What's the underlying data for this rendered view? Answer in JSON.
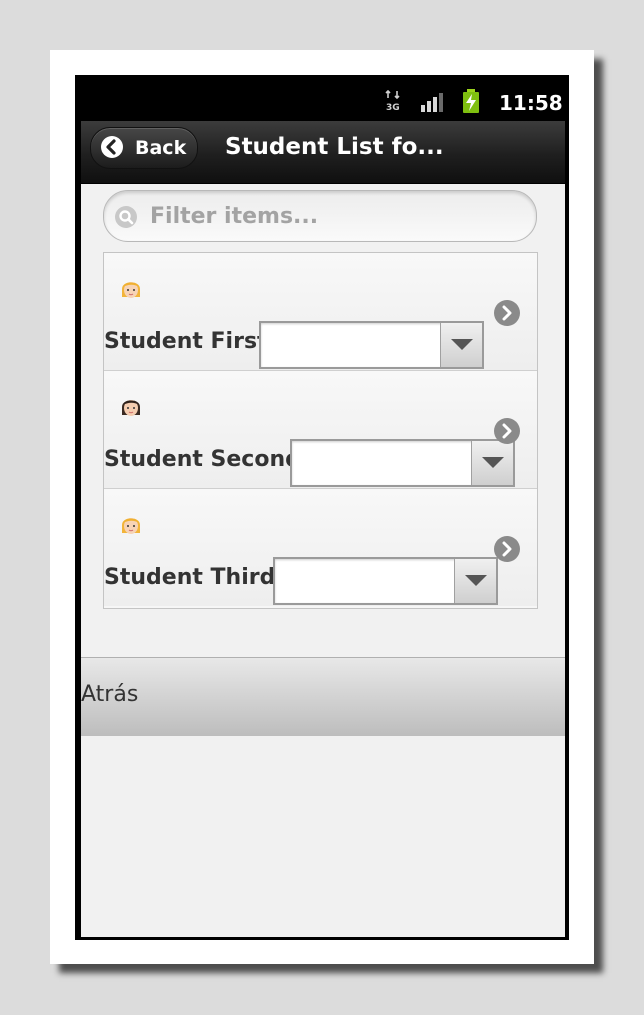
{
  "status_bar": {
    "network": "3G",
    "time": "11:58"
  },
  "header": {
    "back_label": "Back",
    "title": "Student List fo..."
  },
  "filter": {
    "placeholder": "Filter items...",
    "value": ""
  },
  "students": [
    {
      "name": "Student First",
      "avatar": "blonde-girl-avatar-icon",
      "selected": ""
    },
    {
      "name": "Student Second",
      "avatar": "brunette-girl-avatar-icon",
      "selected": ""
    },
    {
      "name": "Student Third",
      "avatar": "blonde-girl-avatar-icon",
      "selected": ""
    }
  ],
  "footer": {
    "label": "Atrás"
  },
  "colors": {
    "header_bg": "#1f1f1f",
    "screen_bg": "#f1f1f1",
    "chevron": "#8a8a8a"
  }
}
